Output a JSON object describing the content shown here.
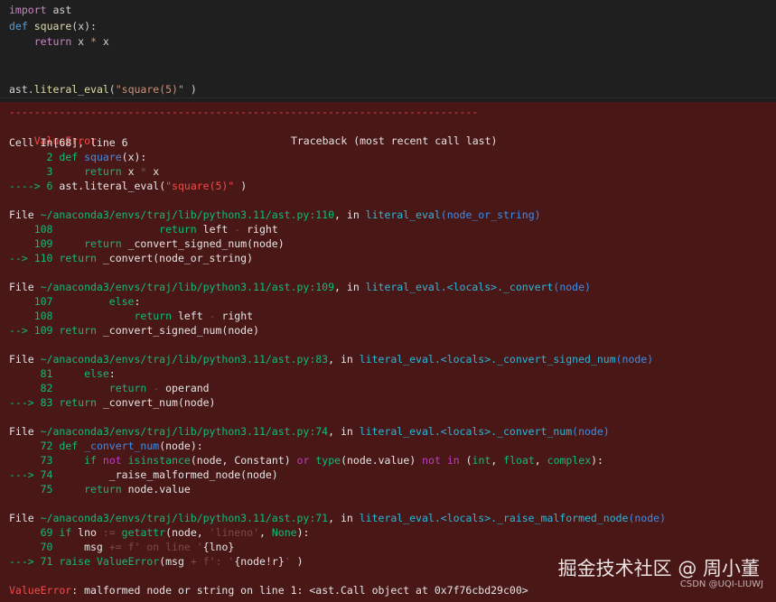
{
  "code_cell": {
    "lines": [
      {
        "parts": [
          [
            "import",
            "kwc"
          ],
          [
            " ast",
            "op"
          ]
        ]
      },
      {
        "parts": [
          [
            "def",
            "kw"
          ],
          [
            " ",
            "op"
          ],
          [
            "square",
            "fnd"
          ],
          [
            "(x):",
            "op"
          ]
        ]
      },
      {
        "parts": [
          [
            "    ",
            "op"
          ],
          [
            "return",
            "kwc"
          ],
          [
            " x ",
            "op"
          ],
          [
            "*",
            "str"
          ],
          [
            " x",
            "op"
          ]
        ]
      },
      {
        "parts": [
          [
            "",
            "op"
          ]
        ]
      },
      {
        "parts": [
          [
            "",
            "op"
          ]
        ]
      },
      {
        "parts": [
          [
            "ast.",
            "op"
          ],
          [
            "literal_eval",
            "fnd"
          ],
          [
            "(",
            "op"
          ],
          [
            "\"square(5)\"",
            "str"
          ],
          [
            " )",
            "op"
          ]
        ]
      }
    ]
  },
  "traceback": {
    "dash_line": "---------------------------------------------------------------------------",
    "error_name": "ValueError",
    "traceback_header": "Traceback (most recent call last)",
    "lines": [
      {
        "parts": [
          [
            "Cell ",
            "white"
          ],
          [
            "In[68], line 6",
            "white"
          ]
        ]
      },
      {
        "parts": [
          [
            "      2 ",
            "dgreen"
          ],
          [
            "def",
            "dgreen"
          ],
          [
            " ",
            "op"
          ],
          [
            "square",
            "blue"
          ],
          [
            "(x):",
            "white"
          ]
        ]
      },
      {
        "parts": [
          [
            "      3 ",
            "dgreen"
          ],
          [
            "    ",
            "op"
          ],
          [
            "return",
            "dgreen"
          ],
          [
            " x ",
            "white"
          ],
          [
            "*",
            "dim"
          ],
          [
            " x",
            "white"
          ]
        ]
      },
      {
        "parts": [
          [
            "----> 6 ",
            "dgreen"
          ],
          [
            "ast",
            "white"
          ],
          [
            ".",
            "white"
          ],
          [
            "literal_eval(",
            "white"
          ],
          [
            "\"square(5)\"",
            "err"
          ],
          [
            " )",
            "white"
          ]
        ]
      },
      {
        "parts": [
          [
            "",
            "op"
          ]
        ]
      },
      {
        "parts": [
          [
            "File ",
            "white"
          ],
          [
            "~/anaconda3/envs/traj/lib/python3.11/ast.py:110",
            "dgreen"
          ],
          [
            ", in ",
            "white"
          ],
          [
            "literal_eval",
            "cyan"
          ],
          [
            "(node_or_string)",
            "blue"
          ]
        ]
      },
      {
        "parts": [
          [
            "    108 ",
            "dgreen"
          ],
          [
            "                ",
            "op"
          ],
          [
            "return",
            "dgreen"
          ],
          [
            " left ",
            "white"
          ],
          [
            "-",
            "dim"
          ],
          [
            " right",
            "white"
          ]
        ]
      },
      {
        "parts": [
          [
            "    109 ",
            "dgreen"
          ],
          [
            "    ",
            "op"
          ],
          [
            "return",
            "dgreen"
          ],
          [
            " _convert_signed_num(node)",
            "white"
          ]
        ]
      },
      {
        "parts": [
          [
            "--> 110 ",
            "dgreen"
          ],
          [
            "return",
            "dgreen"
          ],
          [
            " _convert(node_or_string)",
            "white"
          ]
        ]
      },
      {
        "parts": [
          [
            "",
            "op"
          ]
        ]
      },
      {
        "parts": [
          [
            "File ",
            "white"
          ],
          [
            "~/anaconda3/envs/traj/lib/python3.11/ast.py:109",
            "dgreen"
          ],
          [
            ", in ",
            "white"
          ],
          [
            "literal_eval.<locals>._convert",
            "cyan"
          ],
          [
            "(node)",
            "blue"
          ]
        ]
      },
      {
        "parts": [
          [
            "    107 ",
            "dgreen"
          ],
          [
            "        ",
            "op"
          ],
          [
            "else",
            "dgreen"
          ],
          [
            ":",
            "white"
          ]
        ]
      },
      {
        "parts": [
          [
            "    108 ",
            "dgreen"
          ],
          [
            "            ",
            "op"
          ],
          [
            "return",
            "dgreen"
          ],
          [
            " left ",
            "white"
          ],
          [
            "-",
            "dim"
          ],
          [
            " right",
            "white"
          ]
        ]
      },
      {
        "parts": [
          [
            "--> 109 ",
            "dgreen"
          ],
          [
            "return",
            "dgreen"
          ],
          [
            " _convert_signed_num(node)",
            "white"
          ]
        ]
      },
      {
        "parts": [
          [
            "",
            "op"
          ]
        ]
      },
      {
        "parts": [
          [
            "File ",
            "white"
          ],
          [
            "~/anaconda3/envs/traj/lib/python3.11/ast.py:83",
            "dgreen"
          ],
          [
            ", in ",
            "white"
          ],
          [
            "literal_eval.<locals>._convert_signed_num",
            "cyan"
          ],
          [
            "(node)",
            "blue"
          ]
        ]
      },
      {
        "parts": [
          [
            "     81 ",
            "dgreen"
          ],
          [
            "    ",
            "op"
          ],
          [
            "else",
            "dgreen"
          ],
          [
            ":",
            "white"
          ]
        ]
      },
      {
        "parts": [
          [
            "     82 ",
            "dgreen"
          ],
          [
            "        ",
            "op"
          ],
          [
            "return",
            "dgreen"
          ],
          [
            " ",
            "op"
          ],
          [
            "-",
            "dim"
          ],
          [
            " operand",
            "white"
          ]
        ]
      },
      {
        "parts": [
          [
            "---> 83 ",
            "dgreen"
          ],
          [
            "return",
            "dgreen"
          ],
          [
            " _convert_num(node)",
            "white"
          ]
        ]
      },
      {
        "parts": [
          [
            "",
            "op"
          ]
        ]
      },
      {
        "parts": [
          [
            "File ",
            "white"
          ],
          [
            "~/anaconda3/envs/traj/lib/python3.11/ast.py:74",
            "dgreen"
          ],
          [
            ", in ",
            "white"
          ],
          [
            "literal_eval.<locals>._convert_num",
            "cyan"
          ],
          [
            "(node)",
            "blue"
          ]
        ]
      },
      {
        "parts": [
          [
            "     72 ",
            "dgreen"
          ],
          [
            "def",
            "dgreen"
          ],
          [
            " ",
            "op"
          ],
          [
            "_convert_num",
            "blue"
          ],
          [
            "(node):",
            "white"
          ]
        ]
      },
      {
        "parts": [
          [
            "     73 ",
            "dgreen"
          ],
          [
            "    ",
            "op"
          ],
          [
            "if",
            "dgreen"
          ],
          [
            " ",
            "op"
          ],
          [
            "not",
            "mag"
          ],
          [
            " ",
            "op"
          ],
          [
            "isinstance",
            "dgreen"
          ],
          [
            "(node, Constant) ",
            "white"
          ],
          [
            "or",
            "mag"
          ],
          [
            " ",
            "op"
          ],
          [
            "type",
            "dgreen"
          ],
          [
            "(node",
            "white"
          ],
          [
            ".",
            "white"
          ],
          [
            "value) ",
            "white"
          ],
          [
            "not",
            "mag"
          ],
          [
            " ",
            "op"
          ],
          [
            "in",
            "mag"
          ],
          [
            " (",
            "white"
          ],
          [
            "int",
            "dgreen"
          ],
          [
            ", ",
            "white"
          ],
          [
            "float",
            "dgreen"
          ],
          [
            ", ",
            "white"
          ],
          [
            "complex",
            "dgreen"
          ],
          [
            "):",
            "white"
          ]
        ]
      },
      {
        "parts": [
          [
            "---> 74 ",
            "dgreen"
          ],
          [
            "        _raise_malformed_node(node)",
            "white"
          ]
        ]
      },
      {
        "parts": [
          [
            "     75 ",
            "dgreen"
          ],
          [
            "    ",
            "op"
          ],
          [
            "return",
            "dgreen"
          ],
          [
            " node",
            "white"
          ],
          [
            ".",
            "white"
          ],
          [
            "value",
            "white"
          ]
        ]
      },
      {
        "parts": [
          [
            "",
            "op"
          ]
        ]
      },
      {
        "parts": [
          [
            "File ",
            "white"
          ],
          [
            "~/anaconda3/envs/traj/lib/python3.11/ast.py:71",
            "dgreen"
          ],
          [
            ", in ",
            "white"
          ],
          [
            "literal_eval.<locals>._raise_malformed_node",
            "cyan"
          ],
          [
            "(node)",
            "blue"
          ]
        ]
      },
      {
        "parts": [
          [
            "     69 ",
            "dgreen"
          ],
          [
            "if",
            "dgreen"
          ],
          [
            " lno ",
            "white"
          ],
          [
            ":=",
            "dim"
          ],
          [
            " ",
            "op"
          ],
          [
            "getattr",
            "dgreen"
          ],
          [
            "(node, ",
            "white"
          ],
          [
            "'lineno'",
            "dim"
          ],
          [
            ", ",
            "white"
          ],
          [
            "None",
            "dgreen"
          ],
          [
            "):",
            "white"
          ]
        ]
      },
      {
        "parts": [
          [
            "     70 ",
            "dgreen"
          ],
          [
            "    msg ",
            "white"
          ],
          [
            "+=",
            "dim"
          ],
          [
            " ",
            "op"
          ],
          [
            "f' on line '",
            "dim"
          ],
          [
            "{",
            "white"
          ],
          [
            "lno",
            "white"
          ],
          [
            "}",
            "white"
          ]
        ]
      },
      {
        "parts": [
          [
            "---> 71 ",
            "dgreen"
          ],
          [
            "raise",
            "dgreen"
          ],
          [
            " ",
            "op"
          ],
          [
            "ValueError",
            "dgreen"
          ],
          [
            "(msg ",
            "white"
          ],
          [
            "+",
            "dim"
          ],
          [
            " ",
            "op"
          ],
          [
            "f': '",
            "dim"
          ],
          [
            "{",
            "white"
          ],
          [
            "node",
            "white"
          ],
          [
            "!r}",
            "white"
          ],
          [
            "'",
            "dim"
          ],
          [
            " )",
            "white"
          ]
        ]
      },
      {
        "parts": [
          [
            "",
            "op"
          ]
        ]
      },
      {
        "parts": [
          [
            "ValueError",
            "err"
          ],
          [
            ": malformed node or string on line 1: <ast.Call object at 0x7f76cbd29c00>",
            "white"
          ]
        ]
      }
    ]
  },
  "watermark": {
    "main": "掘金技术社区 @ 周小董",
    "sub": "CSDN @UQI-LIUWJ"
  }
}
